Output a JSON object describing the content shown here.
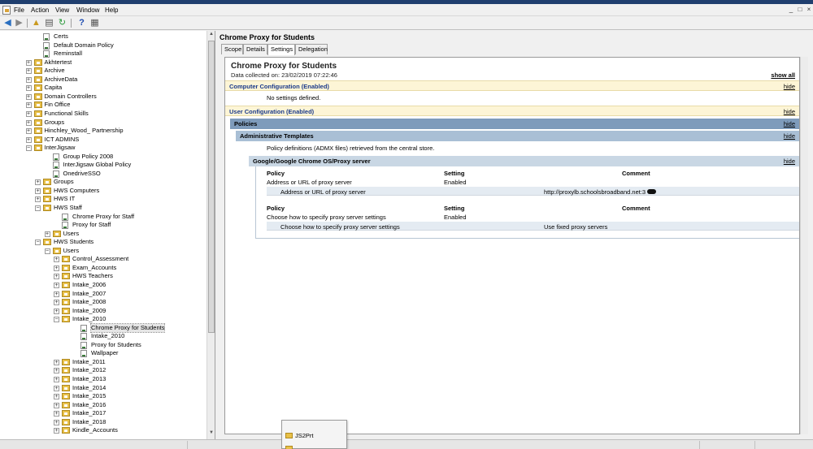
{
  "menu": [
    "File",
    "Action",
    "View",
    "Window",
    "Help"
  ],
  "toolbar_icons": [
    "back-arrow-icon",
    "forward-arrow-icon",
    "up-folder-icon",
    "show-hide-tree-icon",
    "refresh-icon",
    "help-icon",
    "properties-icon"
  ],
  "tree": [
    {
      "label": "Certs",
      "type": "gpo",
      "depth": 3,
      "expander": ""
    },
    {
      "label": "Default Domain Policy",
      "type": "gpo",
      "depth": 3,
      "expander": ""
    },
    {
      "label": "Reminstall",
      "type": "gpo",
      "depth": 3,
      "expander": ""
    },
    {
      "label": "Akhtertest",
      "type": "folder",
      "depth": 2,
      "expander": "+"
    },
    {
      "label": "Archive",
      "type": "folder",
      "depth": 2,
      "expander": "+"
    },
    {
      "label": "ArchiveData",
      "type": "folder",
      "depth": 2,
      "expander": "+"
    },
    {
      "label": "Capita",
      "type": "folder",
      "depth": 2,
      "expander": "+"
    },
    {
      "label": "Domain Controllers",
      "type": "folder",
      "depth": 2,
      "expander": "+"
    },
    {
      "label": "Fin Office",
      "type": "folder",
      "depth": 2,
      "expander": "+"
    },
    {
      "label": "Functional Skills",
      "type": "folder",
      "depth": 2,
      "expander": "+"
    },
    {
      "label": "Groups",
      "type": "folder",
      "depth": 2,
      "expander": "+"
    },
    {
      "label": "Hinchley_Wood_ Partnership",
      "type": "folder",
      "depth": 2,
      "expander": "+"
    },
    {
      "label": "ICT ADMINS",
      "type": "folder",
      "depth": 2,
      "expander": "+"
    },
    {
      "label": "InterJigsaw",
      "type": "folder",
      "depth": 2,
      "expander": "-"
    },
    {
      "label": "Group Policy 2008",
      "type": "gpo",
      "depth": 4,
      "expander": ""
    },
    {
      "label": "InterJigsaw Global Policy",
      "type": "gpo",
      "depth": 4,
      "expander": ""
    },
    {
      "label": "OnedriveSSO",
      "type": "gpo",
      "depth": 4,
      "expander": ""
    },
    {
      "label": "Groups",
      "type": "folder",
      "depth": 3,
      "expander": "+"
    },
    {
      "label": "HWS Computers",
      "type": "folder",
      "depth": 3,
      "expander": "+"
    },
    {
      "label": "HWS IT",
      "type": "folder",
      "depth": 3,
      "expander": "+"
    },
    {
      "label": "HWS Staff",
      "type": "folder",
      "depth": 3,
      "expander": "-"
    },
    {
      "label": "Chrome Proxy for Staff",
      "type": "gpo",
      "depth": 5,
      "expander": ""
    },
    {
      "label": "Proxy for Staff",
      "type": "gpo",
      "depth": 5,
      "expander": ""
    },
    {
      "label": "Users",
      "type": "folder",
      "depth": 4,
      "expander": "+"
    },
    {
      "label": "HWS Students",
      "type": "folder",
      "depth": 3,
      "expander": "-"
    },
    {
      "label": "Users",
      "type": "folder",
      "depth": 4,
      "expander": "-"
    },
    {
      "label": "Control_Assessment",
      "type": "folder",
      "depth": 5,
      "expander": "+"
    },
    {
      "label": "Exam_Accounts",
      "type": "folder",
      "depth": 5,
      "expander": "+"
    },
    {
      "label": "HWS Teachers",
      "type": "folder",
      "depth": 5,
      "expander": "+"
    },
    {
      "label": "Intake_2006",
      "type": "folder",
      "depth": 5,
      "expander": "+"
    },
    {
      "label": "Intake_2007",
      "type": "folder",
      "depth": 5,
      "expander": "+"
    },
    {
      "label": "Intake_2008",
      "type": "folder",
      "depth": 5,
      "expander": "+"
    },
    {
      "label": "Intake_2009",
      "type": "folder",
      "depth": 5,
      "expander": "+"
    },
    {
      "label": "Intake_2010",
      "type": "folder",
      "depth": 5,
      "expander": "-"
    },
    {
      "label": "Chrome Proxy for Students",
      "type": "gpo",
      "depth": 7,
      "expander": "",
      "selected": true
    },
    {
      "label": "Intake_2010",
      "type": "gpo",
      "depth": 7,
      "expander": ""
    },
    {
      "label": "Proxy for Students",
      "type": "gpo",
      "depth": 7,
      "expander": ""
    },
    {
      "label": "Wallpaper",
      "type": "gpo",
      "depth": 7,
      "expander": ""
    },
    {
      "label": "Intake_2011",
      "type": "folder",
      "depth": 5,
      "expander": "+"
    },
    {
      "label": "Intake_2012",
      "type": "folder",
      "depth": 5,
      "expander": "+"
    },
    {
      "label": "Intake_2013",
      "type": "folder",
      "depth": 5,
      "expander": "+"
    },
    {
      "label": "Intake_2014",
      "type": "folder",
      "depth": 5,
      "expander": "+"
    },
    {
      "label": "Intake_2015",
      "type": "folder",
      "depth": 5,
      "expander": "+"
    },
    {
      "label": "Intake_2016",
      "type": "folder",
      "depth": 5,
      "expander": "+"
    },
    {
      "label": "Intake_2017",
      "type": "folder",
      "depth": 5,
      "expander": "+"
    },
    {
      "label": "Intake_2018",
      "type": "folder",
      "depth": 5,
      "expander": "+"
    },
    {
      "label": "Kindle_Accounts",
      "type": "folder",
      "depth": 5,
      "expander": "+"
    }
  ],
  "right": {
    "title": "Chrome Proxy for Students",
    "tabs": [
      "Scope",
      "Details",
      "Settings",
      "Delegation"
    ],
    "active_tab": 2
  },
  "report": {
    "title": "Chrome Proxy for Students",
    "collected": "Data collected on: 23/02/2019 07:22:46",
    "show_all": "show all",
    "hide": "hide",
    "computer_config": "Computer Configuration (Enabled)",
    "no_settings": "No settings defined.",
    "user_config": "User Configuration (Enabled)",
    "policies": "Policies",
    "admin_templates": "Administrative Templates",
    "admx_note": "Policy definitions (ADMX files) retrieved from the central store.",
    "google_section": "Google/Google Chrome OS/Proxy server",
    "col_policy": "Policy",
    "col_setting": "Setting",
    "col_comment": "Comment",
    "p1_name": "Address or URL of proxy server",
    "p1_setting": "Enabled",
    "p1_sub_label": "Address or URL of proxy server",
    "p1_sub_value": "http://proxylb.schoolsbroadband.net:3",
    "p2_name": "Choose how to specify proxy server settings",
    "p2_setting": "Enabled",
    "p2_sub_label": "Choose how to specify proxy server settings",
    "p2_sub_value": "Use fixed proxy servers"
  },
  "popup": {
    "item": "JS2Prt"
  }
}
